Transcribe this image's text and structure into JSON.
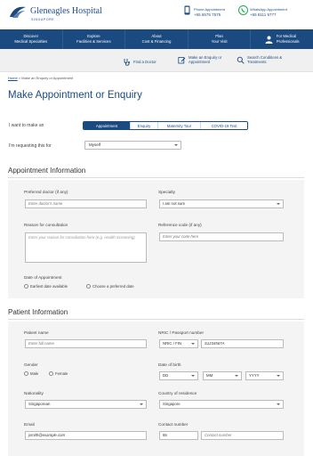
{
  "header": {
    "brand_name": "Gleneagles Hospital",
    "brand_sub": "SINGAPORE",
    "phone": {
      "label": "Phone Appointment",
      "number": "+65 6575 7575",
      "icon": "phone-icon"
    },
    "whatsapp": {
      "label": "WhatsApp Appointment",
      "number": "+65 8111 9777",
      "icon": "whatsapp-icon"
    },
    "colors": {
      "brand": "#1b4a80",
      "whatsapp": "#25a85a",
      "phone": "#1b4a80"
    }
  },
  "nav": {
    "items": [
      {
        "line1": "Discover",
        "line2": "Medical Specialties"
      },
      {
        "line1": "Explore",
        "line2": "Facilities & Services"
      },
      {
        "line1": "About",
        "line2": "Cost & Financing"
      },
      {
        "line1": "Plan",
        "line2": "Your Visit"
      }
    ],
    "special": {
      "line1": "For Medical",
      "line2": "Professionals",
      "icon": "doctor-icon"
    }
  },
  "subnav": {
    "find_doctor": "Find a Doctor",
    "appt_line1": "Make an Enquiry or",
    "appt_line2": "Appointment",
    "search_line1": "Search Conditions &",
    "search_line2": "Treatments"
  },
  "breadcrumb": {
    "home": "Home",
    "sep": " > ",
    "current": "Make an Enquiry or Appointment"
  },
  "page_title": "Make Appointment or Enquiry",
  "form": {
    "make_label": "I want to make an",
    "tabs": [
      "Appointment",
      "Enquiry",
      "Maternity Tour",
      "COVID-19 Test"
    ],
    "active_tab": "Appointment",
    "requesting_label": "I'm requesting this for",
    "requesting_value": "Myself",
    "appointment": {
      "title": "Appointment Information",
      "doctor_label": "Preferred doctor (if any)",
      "doctor_placeholder": "Enter doctor's name",
      "specialty_label": "Specialty",
      "specialty_value": "I am not sure",
      "reason_label": "Reason for consultation",
      "reason_placeholder": "Enter your reason for consultation here (e.g. Health Screening)",
      "ref_label": "Reference code (if any)",
      "ref_placeholder": "Enter your code here",
      "date_label": "Date of Appointment",
      "date_options": [
        "Earliest date available",
        "Choose a preferred date"
      ]
    },
    "patient": {
      "title": "Patient Information",
      "name_label": "Patient name",
      "name_placeholder": "Enter full name",
      "nric_label": "NRIC / Passport number",
      "nric_type": "NRIC / FIN",
      "nric_placeholder": "S1234567A",
      "gender_label": "Gender",
      "gender_options": [
        "Male",
        "Female"
      ],
      "dob_label": "Date of birth",
      "dob_dd": "DD",
      "dob_mm": "MM",
      "dob_yyyy": "YYYY",
      "nationality_label": "Nationality",
      "nationality_value": "Singaporean",
      "country_label": "Country of residence",
      "country_value": "Singapore",
      "email_label": "Email",
      "email_placeholder": "jsmith@example.com",
      "contact_label": "Contact number",
      "contact_code": "65",
      "contact_placeholder": "Contact number"
    }
  }
}
